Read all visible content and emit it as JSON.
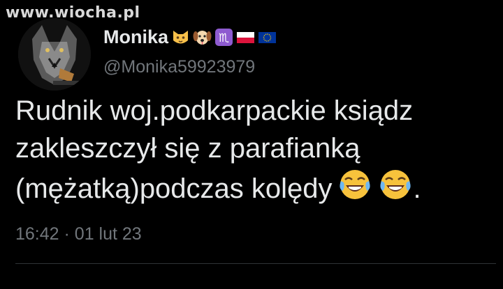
{
  "watermark": {
    "text": "www.wiocha.pl"
  },
  "author": {
    "display_name": "Monika",
    "handle": "@Monika59923979",
    "name_emoji_icons": [
      "cat-face-icon",
      "dog-face-icon",
      "scorpio-sign-icon",
      "poland-flag-icon",
      "eu-flag-icon"
    ]
  },
  "tweet": {
    "lines": [
      "Rudnik woj.podkarpackie ksiądz",
      "zakleszczył się z parafianką",
      "(mężatką)podczas kolędy"
    ],
    "trailing_emoji_icons": [
      "tears-of-joy-icon",
      "tears-of-joy-icon"
    ],
    "trailing_punct": "."
  },
  "meta": {
    "time": "16:42",
    "separator": "·",
    "date": "01 lut 23"
  },
  "colors": {
    "background": "#000000",
    "text": "#e7e9ea",
    "muted": "#71767b",
    "divider": "#2f3336"
  }
}
